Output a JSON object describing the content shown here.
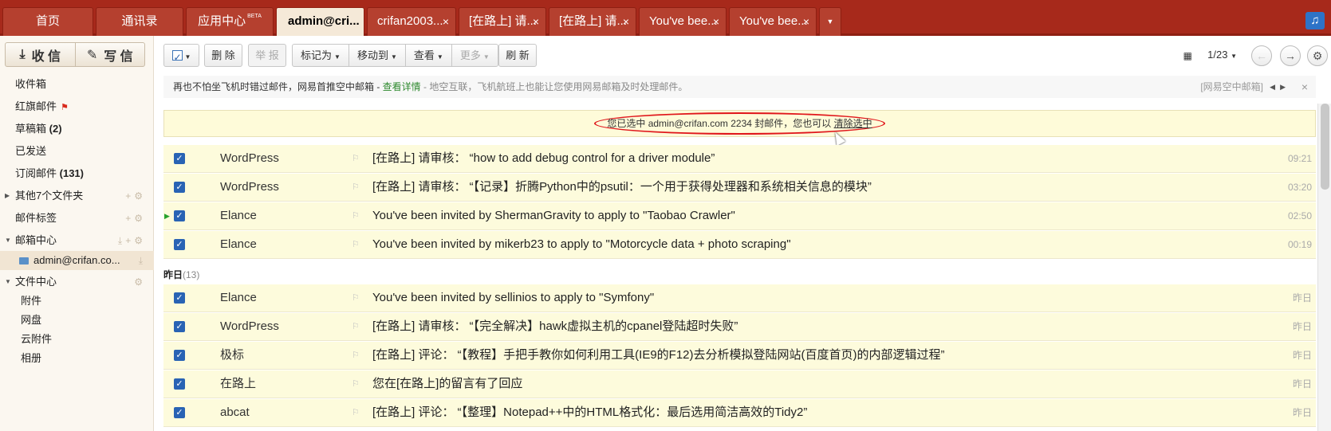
{
  "tabs": [
    {
      "label": "首页",
      "closable": false
    },
    {
      "label": "通讯录",
      "closable": false
    },
    {
      "label": "应用中心",
      "badge": "BETA",
      "closable": false
    },
    {
      "label": "admin@cri...",
      "closable": false,
      "active": true
    },
    {
      "label": "crifan2003...",
      "closable": true
    },
    {
      "label": "[在路上] 请...",
      "closable": true
    },
    {
      "label": "[在路上] 请...",
      "closable": true
    },
    {
      "label": "You've bee...",
      "closable": true
    },
    {
      "label": "You've bee...",
      "closable": true
    }
  ],
  "tab_close_glyph": "×",
  "sidebar": {
    "receive_label": "收 信",
    "compose_label": "写 信",
    "items": [
      {
        "label": "收件箱"
      },
      {
        "label": "红旗邮件"
      },
      {
        "label": "草稿箱",
        "count": "(2)"
      },
      {
        "label": "已发送"
      },
      {
        "label": "订阅邮件",
        "count": "(131)"
      },
      {
        "label": "其他7个文件夹"
      },
      {
        "label": "邮件标签"
      },
      {
        "label": "邮箱中心"
      },
      {
        "label": "admin@crifan.co..."
      },
      {
        "label": "文件中心"
      },
      {
        "label": "附件"
      },
      {
        "label": "网盘"
      },
      {
        "label": "云附件"
      },
      {
        "label": "相册"
      }
    ]
  },
  "toolbar": {
    "delete": "删 除",
    "report": "举 报",
    "mark_as": "标记为",
    "move_to": "移动到",
    "view": "查看",
    "more": "更多",
    "refresh": "刷 新"
  },
  "pager": {
    "page": "1/23"
  },
  "notice": {
    "text": "再也不怕坐飞机时错过邮件，网易首推空中邮箱 - ",
    "link": "查看详情",
    "desc": " - 地空互联，飞机航班上也能让您使用网易邮箱及时处理邮件。",
    "source": "[网易空中邮箱]"
  },
  "selection": {
    "text": "您已选中 admin@crifan.com 2234 封邮件，您也可以 ",
    "clear_link": "清除选中"
  },
  "mails_today": [
    {
      "sender": "WordPress",
      "subject": "[在路上] 请审核： “how to add debug control for a driver module”",
      "time": "09:21"
    },
    {
      "sender": "WordPress",
      "subject": "[在路上] 请审核： “【记录】折腾Python中的psutil：一个用于获得处理器和系统相关信息的模块”",
      "time": "03:20"
    },
    {
      "sender": "Elance",
      "subject": "You've been invited by ShermanGravity to apply to \"Taobao Crawler\"",
      "time": "02:50"
    },
    {
      "sender": "Elance",
      "subject": "You've been invited by mikerb23 to apply to \"Motorcycle data + photo scraping\"",
      "time": "00:19"
    }
  ],
  "group_yesterday": {
    "label": "昨日",
    "count": "(13)"
  },
  "mails_yesterday": [
    {
      "sender": "Elance",
      "subject": "You've been invited by sellinios to apply to \"Symfony\"",
      "time": "昨日"
    },
    {
      "sender": "WordPress",
      "subject": "[在路上] 请审核： “【完全解决】hawk虚拟主机的cpanel登陆超时失败”",
      "time": "昨日"
    },
    {
      "sender": "极标",
      "subject": "[在路上] 评论： “【教程】手把手教你如何利用工具(IE9的F12)去分析模拟登陆网站(百度首页)的内部逻辑过程”",
      "time": "昨日"
    },
    {
      "sender": "在路上",
      "subject": "您在[在路上]的留言有了回应",
      "time": "昨日"
    },
    {
      "sender": "abcat",
      "subject": "[在路上] 评论： “【整理】Notepad++中的HTML格式化：最后选用简洁高效的Tidy2”",
      "time": "昨日"
    }
  ],
  "colors": {
    "tabbar": "#a7291b",
    "selected_row": "#fdfbdc",
    "checkbox": "#2963b4",
    "highlight_oval": "#e0161b"
  }
}
